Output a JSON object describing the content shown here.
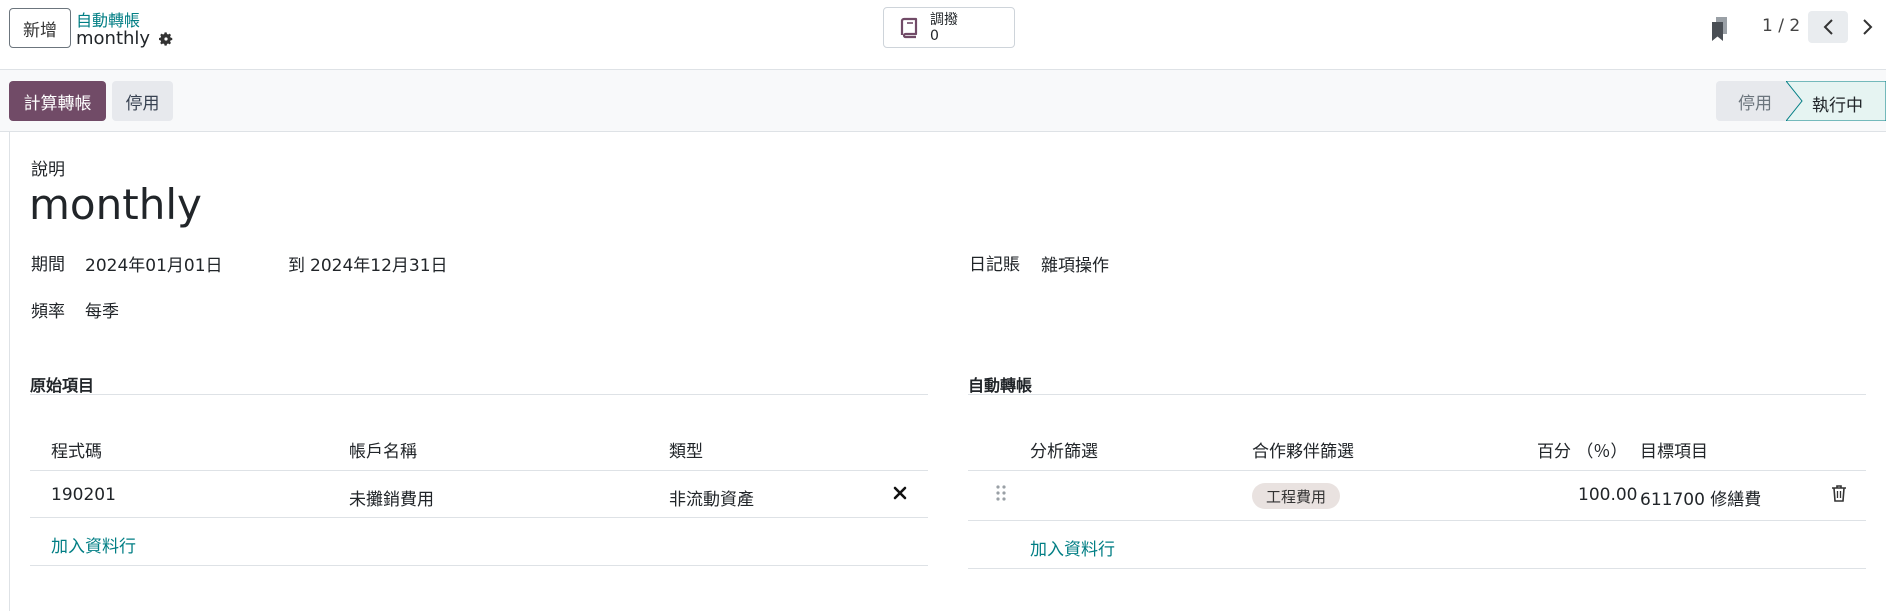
{
  "topbar": {
    "new_label": "新增",
    "breadcrumb_parent": "自動轉帳",
    "breadcrumb_current": "monthly",
    "smart_button": {
      "label": "調撥",
      "count": "0"
    },
    "pager": {
      "value": "1 / 2"
    }
  },
  "actionbar": {
    "compute_label": "計算轉帳",
    "disable_label": "停用",
    "status": {
      "inactive": "停用",
      "active": "執行中"
    }
  },
  "form": {
    "description_label": "說明",
    "title": "monthly",
    "period_label": "期間",
    "date_from": "2024年01月01日",
    "date_to_prefix": "到",
    "date_to": "2024年12月31日",
    "journal_label": "日記賬",
    "journal_value": "雜項操作",
    "frequency_label": "頻率",
    "frequency_value": "每季"
  },
  "source": {
    "section_title": "原始項目",
    "headers": [
      "程式碼",
      "帳戶名稱",
      "類型"
    ],
    "rows": [
      {
        "code": "190201",
        "name": "未攤銷費用",
        "type": "非流動資產"
      }
    ],
    "add_line": "加入資料行"
  },
  "transfers": {
    "section_title": "自動轉帳",
    "headers": [
      "分析篩選",
      "合作夥伴篩選",
      "百分 （％）",
      "目標項目"
    ],
    "rows": [
      {
        "analytic": "",
        "partner_tag": "工程費用",
        "percent": "100.00",
        "target": "611700 修繕費"
      }
    ],
    "add_line": "加入資料行"
  },
  "colors": {
    "primary": "#714b67",
    "link": "#017e84",
    "active_status": "#e6f4f2"
  },
  "icons": [
    "gear-icon",
    "book-icon",
    "bookmark-icon",
    "chevron-left-icon",
    "chevron-right-icon",
    "close-icon",
    "drag-handle-icon",
    "trash-icon"
  ]
}
